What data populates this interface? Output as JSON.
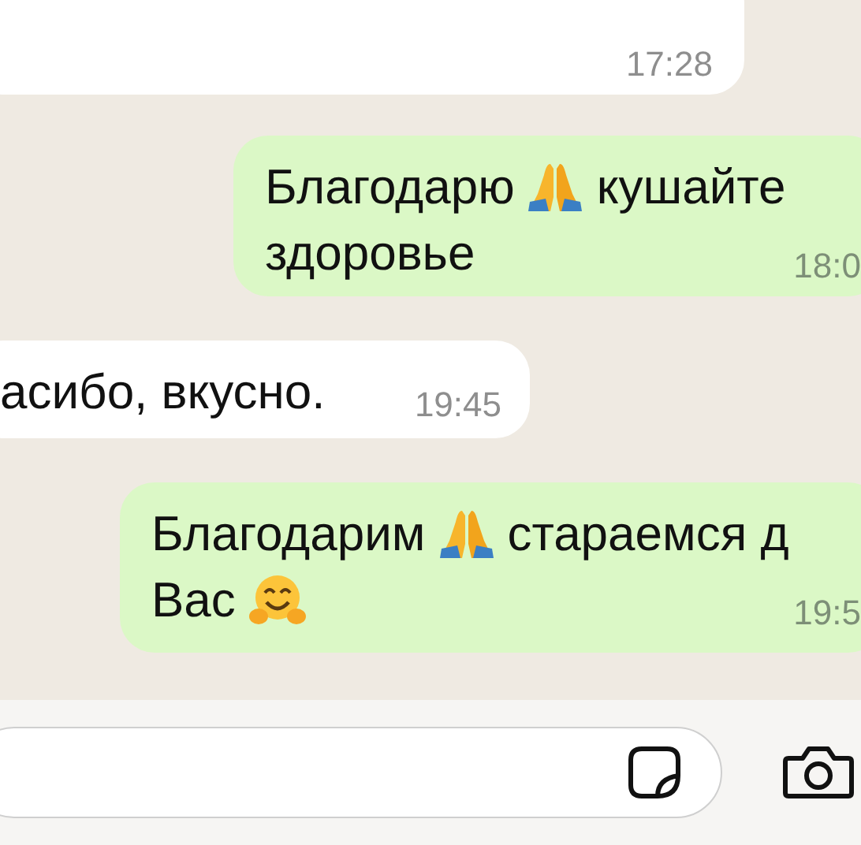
{
  "messages": [
    {
      "kind": "incoming",
      "time": "17:28"
    },
    {
      "kind": "outgoing",
      "lines": [
        [
          {
            "kind": "text",
            "text": "Благодарю"
          },
          {
            "kind": "hands"
          },
          {
            "kind": "text",
            "text": "кушайте"
          }
        ],
        [
          {
            "kind": "text",
            "text": "здоровье"
          }
        ]
      ],
      "time": "18:0"
    },
    {
      "kind": "incoming",
      "lines": [
        [
          {
            "kind": "text",
            "text": "асибо, вкусно."
          }
        ]
      ],
      "time": "19:45"
    },
    {
      "kind": "outgoing",
      "lines": [
        [
          {
            "kind": "text",
            "text": "Благодарим"
          },
          {
            "kind": "hands"
          },
          {
            "kind": "text",
            "text": "стараемся д"
          }
        ],
        [
          {
            "kind": "text",
            "text": "Вас"
          },
          {
            "kind": "hug"
          }
        ]
      ],
      "time": "19:5"
    }
  ]
}
